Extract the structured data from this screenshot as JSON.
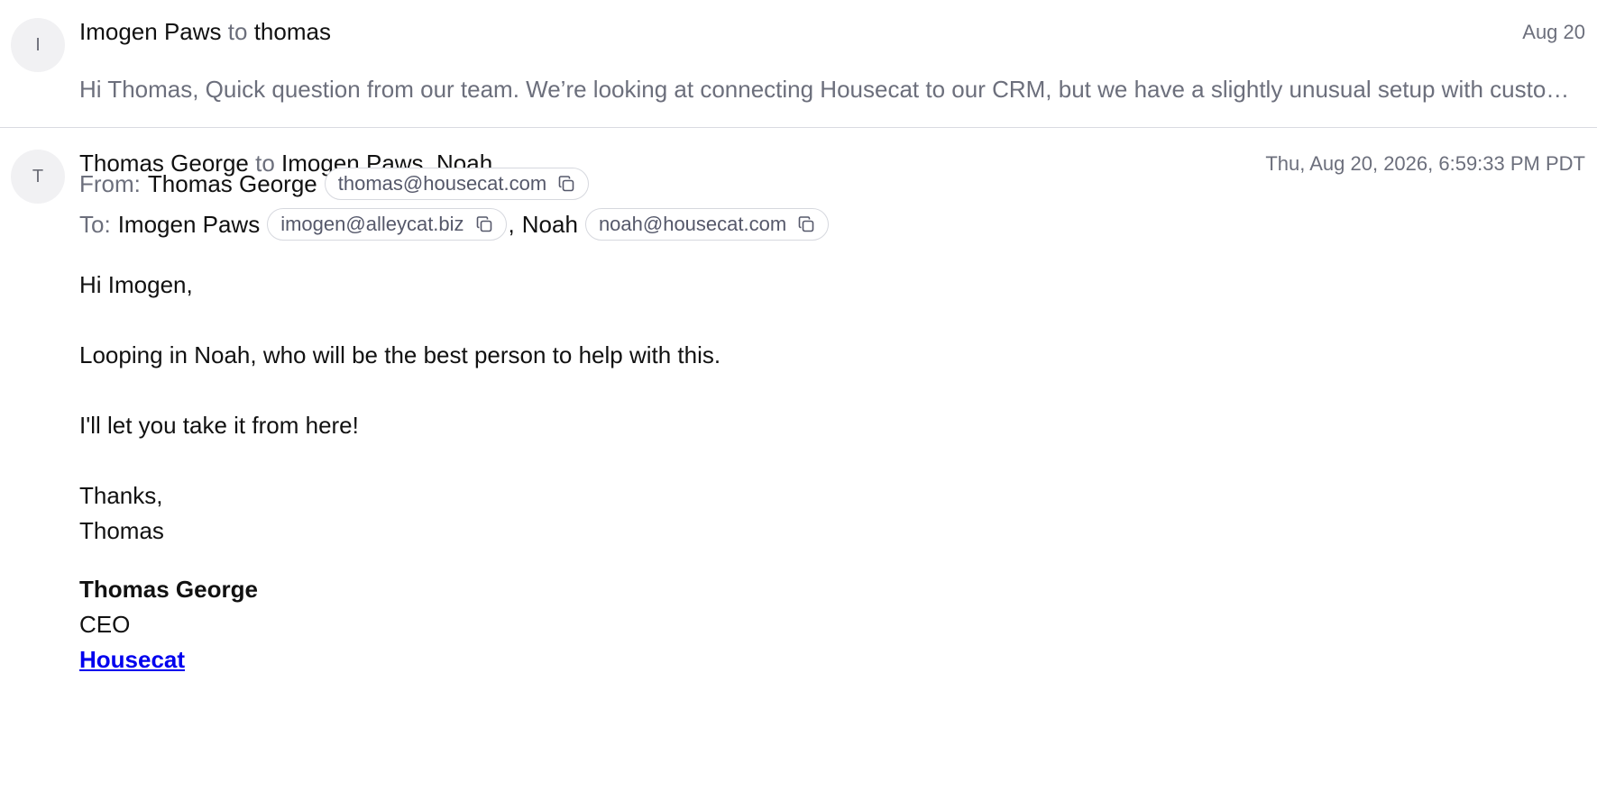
{
  "messages": [
    {
      "avatar_initial": "I",
      "sender": "Imogen Paws",
      "to_word": "to",
      "recipients": "thomas",
      "date": "Aug 20",
      "snippet": "Hi Thomas, Quick question from our team. We’re looking at connecting Housecat to our CRM, but we have a slightly unusual setup with custom lead scoring fields."
    },
    {
      "avatar_initial": "T",
      "sender": "Thomas George",
      "to_word": "to",
      "recipients": "Imogen Paws, Noah",
      "date": "Thu, Aug 20, 2026, 6:59:33 PM PDT",
      "from_label": "From:",
      "from_name": "Thomas George",
      "from_email": "thomas@housecat.com",
      "to_label": "To:",
      "to": [
        {
          "name": "Imogen Paws",
          "email": "imogen@alleycat.biz"
        },
        {
          "name": "Noah",
          "email": "noah@housecat.com"
        }
      ],
      "to_separator": ",",
      "body": {
        "greeting": "Hi Imogen,",
        "line1": "Looping in Noah, who will be the best person to help with this.",
        "line2": "I'll let you take it from here!",
        "closing": "Thanks,",
        "closing_name": "Thomas",
        "signature_name": "Thomas George",
        "signature_title": "CEO",
        "signature_link": "Housecat"
      }
    }
  ],
  "icons": {
    "copy": "copy-icon"
  },
  "colors": {
    "muted": "#6c6f7c",
    "link": "#0000ee",
    "divider": "#d9dbe1"
  }
}
